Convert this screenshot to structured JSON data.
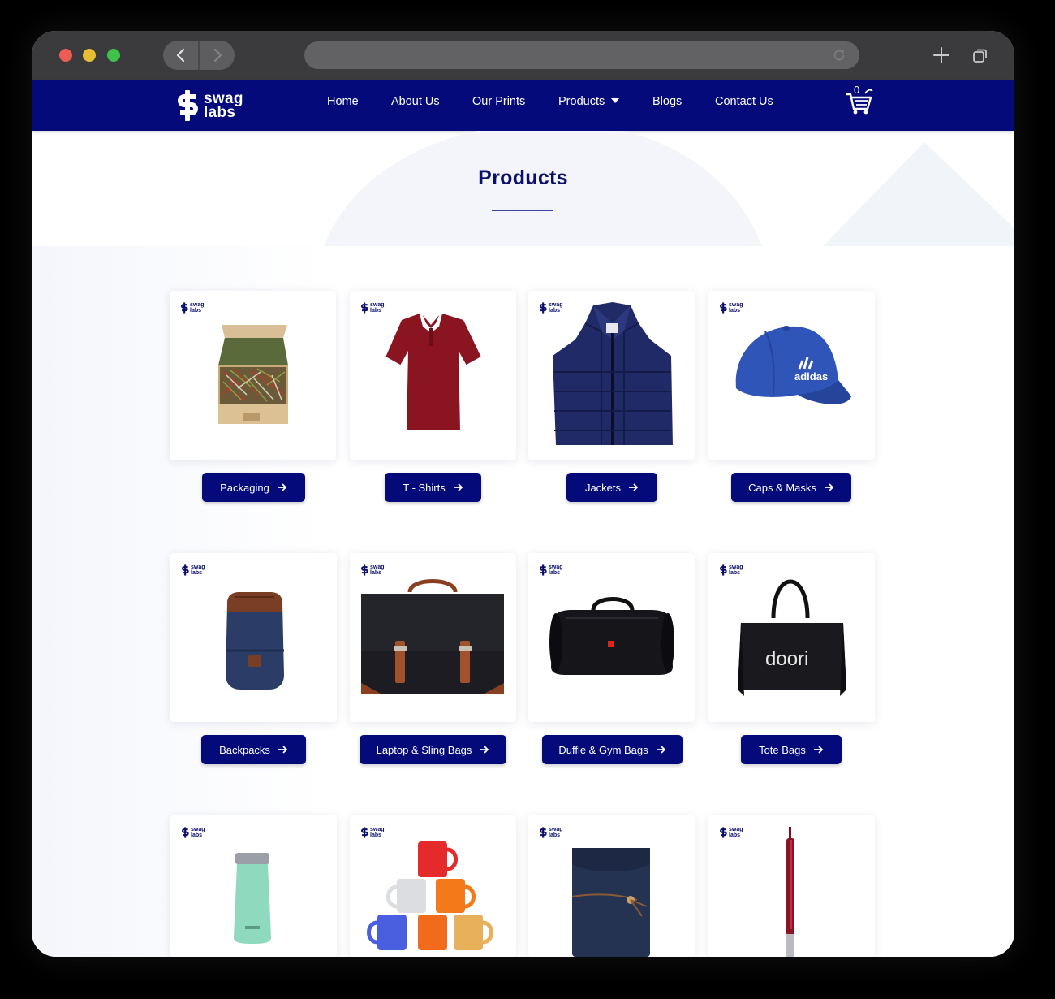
{
  "site": {
    "logo_line1": "swag",
    "logo_line2": "labs",
    "cart_count": "0",
    "brand_color": "#050a7a"
  },
  "nav": {
    "items": [
      {
        "label": "Home"
      },
      {
        "label": "About Us"
      },
      {
        "label": "Our Prints"
      },
      {
        "label": "Products",
        "has_dropdown": true
      },
      {
        "label": "Blogs"
      },
      {
        "label": "Contact Us"
      }
    ]
  },
  "page": {
    "title": "Products"
  },
  "card_logo": {
    "line1": "swag",
    "line2": "labs"
  },
  "products": [
    {
      "label": "Packaging",
      "icon": "gift-box-image"
    },
    {
      "label": "T - Shirts",
      "icon": "polo-shirt-image"
    },
    {
      "label": "Jackets",
      "icon": "vest-jacket-image"
    },
    {
      "label": "Caps & Masks",
      "icon": "cap-image",
      "cap_text": "adidas"
    },
    {
      "label": "Backpacks",
      "icon": "backpack-image"
    },
    {
      "label": "Laptop & Sling Bags",
      "icon": "laptop-bag-image"
    },
    {
      "label": "Duffle & Gym Bags",
      "icon": "duffle-bag-image"
    },
    {
      "label": "Tote Bags",
      "icon": "tote-bag-image",
      "bag_text": "doori"
    },
    {
      "label": "",
      "icon": "bottle-image"
    },
    {
      "label": "",
      "icon": "mugs-image"
    },
    {
      "label": "",
      "icon": "folder-image"
    },
    {
      "label": "",
      "icon": "pen-image"
    }
  ]
}
